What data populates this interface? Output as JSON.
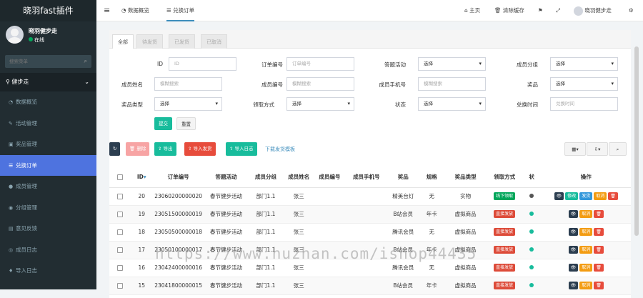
{
  "app": {
    "logo": "晓羽fast插件"
  },
  "user": {
    "name": "晓羽健步走",
    "status": "在线"
  },
  "sidebar": {
    "search_placeholder": "搜索菜单",
    "group": "健步走",
    "items": [
      {
        "label": "数据概览",
        "icon": "dashboard-icon"
      },
      {
        "label": "活动管理",
        "icon": "pin-icon"
      },
      {
        "label": "奖品管理",
        "icon": "gift-icon"
      },
      {
        "label": "兑换订单",
        "icon": "list-icon"
      },
      {
        "label": "成员管理",
        "icon": "user-icon"
      },
      {
        "label": "分组管理",
        "icon": "group-icon"
      },
      {
        "label": "意见反馈",
        "icon": "feedback-icon"
      },
      {
        "label": "成员日志",
        "icon": "log-icon"
      },
      {
        "label": "导入日志",
        "icon": "import-icon"
      }
    ]
  },
  "topbar": {
    "menu_toggle": "≡",
    "tab1": "数据概览",
    "tab2": "兑换订单",
    "home": "主页",
    "clear_cache": "清除缓存",
    "username": "晓羽健步走"
  },
  "tabs": [
    "全部",
    "待发货",
    "已发货",
    "已取消"
  ],
  "filters": {
    "id_label": "ID",
    "id_ph": "ID",
    "order_label": "订单编号",
    "order_ph": "订单编号",
    "activity_label": "答题活动",
    "activity_val": "选择",
    "group_label": "成员分组",
    "group_val": "选择",
    "name_label": "成员姓名",
    "name_ph": "模糊搜索",
    "no_label": "成员编号",
    "no_ph": "模糊搜索",
    "phone_label": "成员手机号",
    "phone_ph": "模糊搜索",
    "prize_label": "奖品",
    "prize_val": "选择",
    "ptype_label": "奖品类型",
    "ptype_val": "选择",
    "receive_label": "领取方式",
    "receive_val": "选择",
    "status_label": "状态",
    "status_val": "选择",
    "time_label": "兑换时间",
    "time_ph": "兑换时间",
    "submit": "提交",
    "reset": "重置"
  },
  "toolbar": {
    "delete": "删除",
    "export": "导出",
    "import_ship": "导入发货",
    "import_log": "导入日志",
    "template": "下载发货模板"
  },
  "columns": [
    "ID",
    "订单编号",
    "答题活动",
    "成员分组",
    "成员姓名",
    "成员编号",
    "成员手机号",
    "奖品",
    "规格",
    "奖品类型",
    "领取方式",
    "状",
    "操作"
  ],
  "rows": [
    {
      "id": "20",
      "order": "23060200000020",
      "activity": "春节健步活动",
      "group": "部门1.1",
      "name": "张三",
      "no": "",
      "phone": "",
      "prize": "精美台灯",
      "spec": "无",
      "ptype": "实物",
      "receive": "线下领取",
      "receive_color": "#00a65a"
    },
    {
      "id": "19",
      "order": "23051500000019",
      "activity": "春节健步活动",
      "group": "部门1.1",
      "name": "张三",
      "no": "",
      "phone": "",
      "prize": "B站会员",
      "spec": "年卡",
      "ptype": "虚拟商品",
      "receive": "直接发放",
      "receive_color": "#dd4b39"
    },
    {
      "id": "18",
      "order": "23050500000018",
      "activity": "春节健步活动",
      "group": "部门1.1",
      "name": "张三",
      "no": "",
      "phone": "",
      "prize": "腾讯会员",
      "spec": "无",
      "ptype": "虚拟商品",
      "receive": "直接发放",
      "receive_color": "#dd4b39"
    },
    {
      "id": "17",
      "order": "23050100000017",
      "activity": "春节健步活动",
      "group": "部门1.1",
      "name": "张三",
      "no": "",
      "phone": "",
      "prize": "B站会员",
      "spec": "年卡",
      "ptype": "虚拟商品",
      "receive": "直接发放",
      "receive_color": "#dd4b39"
    },
    {
      "id": "16",
      "order": "23042400000016",
      "activity": "春节健步活动",
      "group": "部门1.1",
      "name": "张三",
      "no": "",
      "phone": "",
      "prize": "腾讯会员",
      "spec": "无",
      "ptype": "虚拟商品",
      "receive": "直接发放",
      "receive_color": "#dd4b39"
    },
    {
      "id": "15",
      "order": "23041800000015",
      "activity": "春节健步活动",
      "group": "部门1.1",
      "name": "张三",
      "no": "",
      "phone": "",
      "prize": "B站会员",
      "spec": "年卡",
      "ptype": "虚拟商品",
      "receive": "直接发放",
      "receive_color": "#dd4b39"
    }
  ],
  "ops": {
    "view": "👁",
    "edit": "修改",
    "ship": "发货",
    "cancel": "取消",
    "delete": "🗑"
  },
  "watermark": "https://www.huzhan.com/ishop44435"
}
